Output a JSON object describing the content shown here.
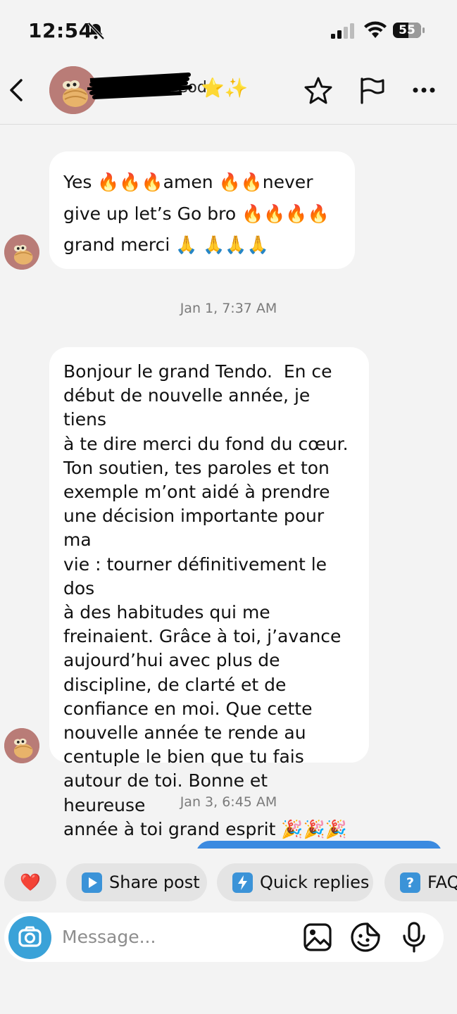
{
  "status_bar": {
    "time": "12:54",
    "battery": "55"
  },
  "header": {
    "contact_name": "Ingrid de Code",
    "name_emoji": "⭐✨",
    "icons": [
      "back-icon",
      "star-icon",
      "flag-icon",
      "more-icon"
    ]
  },
  "messages": [
    {
      "from": "contact",
      "text": "Yes 🔥🔥🔥amen 🔥🔥never\ngive up let’s Go bro 🔥🔥🔥🔥\ngrand merci 🙏 🙏🙏🙏"
    },
    {
      "timestamp": "Jan 1, 7:37 AM"
    },
    {
      "from": "contact",
      "text": "Bonjour le grand Tendo.  En ce\ndébut de nouvelle année, je tiens\nà te dire merci du fond du cœur.\nTon soutien, tes paroles et ton\nexemple m’ont aidé à prendre\nune décision importante pour ma\nvie : tourner définitivement le dos\nà des habitudes qui me\nfreinaient. Grâce à toi, j’avance\naujourd’hui avec plus de\ndiscipline, de clarté et de\nconfiance en moi. Que cette\nnouvelle année te rende au\ncentuple le bien que tu fais\nautour de toi. Bonne et heureuse\nannée à toi grand esprit 🎉🎉🎉"
    },
    {
      "timestamp": "Jan 3, 6:45 AM"
    }
  ],
  "quick_chips": {
    "heart": "❤️",
    "share_post": "Share post",
    "quick_replies": "Quick replies",
    "faq": "FAQ"
  },
  "composer": {
    "placeholder": "Message..."
  },
  "colors": {
    "accent": "#3aa2d8",
    "bubble_bg": "#ffffff",
    "page_bg": "#f3f3f3",
    "chip_bg": "#e4e4e4",
    "sent_bubble": "#3b8ae0"
  }
}
